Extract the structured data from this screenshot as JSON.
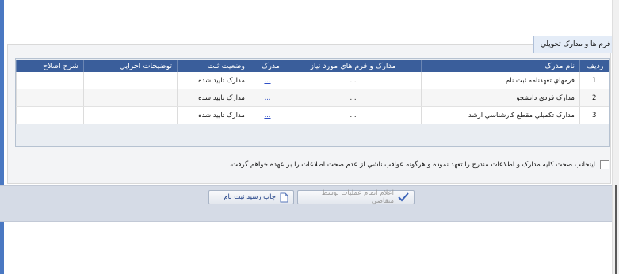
{
  "section": {
    "tab_label": "فرم ها و مدارک تحويلي"
  },
  "grid": {
    "columns": [
      "رديف",
      "نام مدرک",
      "مدارک و فرم هاي مورد نياز",
      "مدرک",
      "وضعيت ثبت",
      "توضيحات اجرايي",
      "شرح اصلاح"
    ],
    "rows": [
      {
        "index": "1",
        "name": "فرمهاي تعهدنامه ثبت نام",
        "required": "...",
        "doc": "...",
        "status": "مدارک تاييد شده",
        "notes": "",
        "fix": ""
      },
      {
        "index": "2",
        "name": "مدارک فردي دانشجو",
        "required": "...",
        "doc": "...",
        "status": "مدارک تاييد شده",
        "notes": "",
        "fix": ""
      },
      {
        "index": "3",
        "name": "مدارک تکميلي مقطع کارشناسي ارشد",
        "required": "...",
        "doc": "...",
        "status": "مدارک تاييد شده",
        "notes": "",
        "fix": ""
      }
    ]
  },
  "confirm": {
    "label": "اينجانب صحت کليه مدارک و اطلاعات مندرج را تعهد نموده و هرگونه عواقب ناشي از عدم صحت اطلاعات را بر عهده خواهم گرفت."
  },
  "buttons": {
    "finish_label": "اعلام اتمام عمليات توسط متقاضي",
    "print_label": "چاپ رسيد ثبت نام"
  },
  "colors": {
    "header": "#3a5e9b",
    "accent": "#4a78c2",
    "link": "#2f4fc7"
  }
}
